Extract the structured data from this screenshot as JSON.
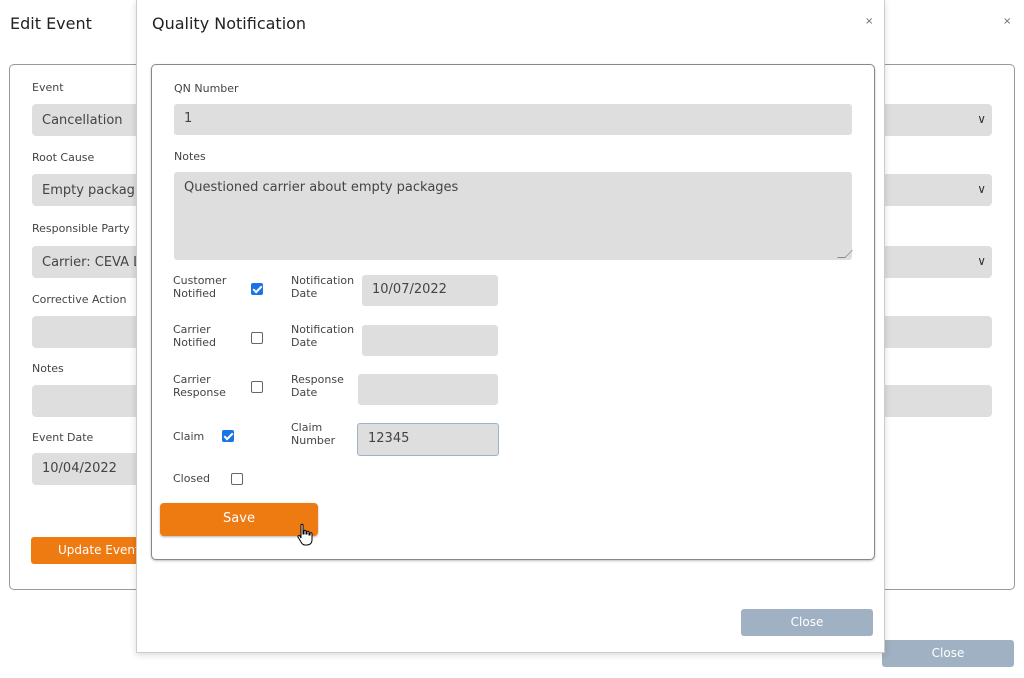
{
  "background_modal": {
    "title": "Edit Event",
    "close_symbol": "×",
    "fields": [
      {
        "label": "Event",
        "value": "Cancellation",
        "has_dropdown": true
      },
      {
        "label": "Root Cause",
        "value": "Empty packag",
        "has_dropdown": true
      },
      {
        "label": "Responsible Party",
        "value": "Carrier: CEVA L",
        "has_dropdown": true
      },
      {
        "label": "Corrective Action",
        "value": "",
        "has_dropdown": false
      },
      {
        "label": "Notes",
        "value": "",
        "has_dropdown": false
      }
    ],
    "event_date": {
      "label": "Event Date",
      "value": "10/04/2022"
    },
    "update_button": "Update Event",
    "close_button": "Close"
  },
  "quality_notification": {
    "title": "Quality Notification",
    "close_symbol": "×",
    "qn_number": {
      "label": "QN Number",
      "value": "1"
    },
    "notes": {
      "label": "Notes",
      "value": "Questioned carrier about empty packages"
    },
    "customer_notified": {
      "label_1": "Customer",
      "label_2": "Notified",
      "checked": true,
      "date_label_1": "Notification",
      "date_label_2": "Date",
      "date_value": "10/07/2022"
    },
    "carrier_notified": {
      "label_1": "Carrier",
      "label_2": "Notified",
      "checked": false,
      "date_label_1": "Notification",
      "date_label_2": "Date",
      "date_value": ""
    },
    "carrier_response": {
      "label_1": "Carrier",
      "label_2": "Response",
      "checked": false,
      "date_label_1": "Response",
      "date_label_2": "Date",
      "date_value": ""
    },
    "claim": {
      "label": "Claim",
      "checked": true,
      "number_label_1": "Claim",
      "number_label_2": "Number",
      "number_value": "12345"
    },
    "closed": {
      "label": "Closed",
      "checked": false
    },
    "save_button": "Save",
    "close_button": "Close"
  },
  "colors": {
    "accent_orange": "#ee7a12",
    "close_button": "#9fb1c2",
    "field_bg": "#dedede",
    "checkbox_checked": "#1a73e8"
  },
  "icons": [
    "close-icon",
    "chevron-down-icon",
    "hand-pointer-cursor-icon"
  ]
}
